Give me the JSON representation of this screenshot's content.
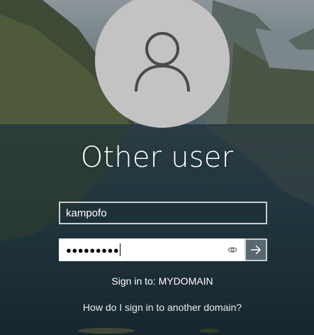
{
  "login": {
    "account_name": "Other user",
    "username_value": "kampofo",
    "password_mask": "●●●●●●●●●",
    "sign_in_to": "Sign in to: MYDOMAIN",
    "other_domain_link": "How do I sign in to another domain?"
  },
  "icons": {
    "avatar": "user-silhouette-icon",
    "reveal": "eye-icon",
    "submit": "arrow-right-icon"
  },
  "colors": {
    "avatar_bg": "#c3c3c3",
    "text": "#ffffff",
    "field_border": "#c9cdd0",
    "password_bg": "#ffffff"
  }
}
